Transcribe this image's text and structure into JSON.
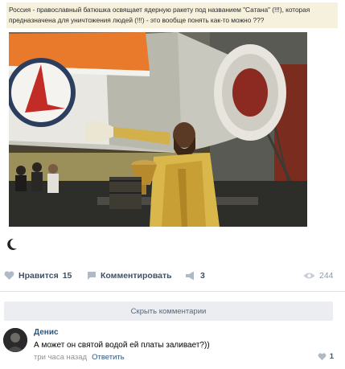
{
  "post": {
    "caption": "Россия - православный батюшка освящает ядерную ракету под названием \"Сатана\" (!!!), которая предназначена для уничтожения людей (!!!) - это вообще понять как-то можно ???",
    "photo_description": "photo"
  },
  "actions": {
    "like_label": "Нравится",
    "like_count": "15",
    "comment_label": "Комментировать",
    "share_count": "3",
    "views_count": "244"
  },
  "comments": {
    "hide_label": "Скрыть комментарии",
    "items": [
      {
        "author": "Денис",
        "text": "А может он святой водой ей платы заливает?))",
        "time": "три часа назад",
        "reply_label": "Ответить",
        "likes": "1"
      }
    ]
  },
  "colors": {
    "link": "#2a5885",
    "action_text": "#3f5064",
    "muted": "#939393",
    "hide_button_bg": "#ebedf0",
    "caption_bg": "#f5f1dc"
  },
  "icons": [
    "moon-icon",
    "heart-icon",
    "comment-icon",
    "share-icon",
    "eye-icon"
  ]
}
